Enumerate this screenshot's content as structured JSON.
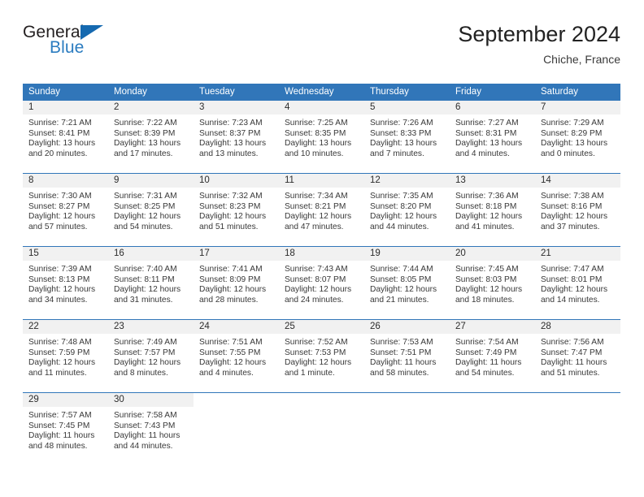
{
  "brand": {
    "name_part1": "General",
    "name_part2": "Blue"
  },
  "header": {
    "title": "September 2024",
    "location": "Chiche, France",
    "accent_color": "#3176b9",
    "brand_blue": "#2b7cc0"
  },
  "weekdays": [
    "Sunday",
    "Monday",
    "Tuesday",
    "Wednesday",
    "Thursday",
    "Friday",
    "Saturday"
  ],
  "weeks": [
    [
      {
        "day": "1",
        "sunrise": "Sunrise: 7:21 AM",
        "sunset": "Sunset: 8:41 PM",
        "daylight": "Daylight: 13 hours and 20 minutes."
      },
      {
        "day": "2",
        "sunrise": "Sunrise: 7:22 AM",
        "sunset": "Sunset: 8:39 PM",
        "daylight": "Daylight: 13 hours and 17 minutes."
      },
      {
        "day": "3",
        "sunrise": "Sunrise: 7:23 AM",
        "sunset": "Sunset: 8:37 PM",
        "daylight": "Daylight: 13 hours and 13 minutes."
      },
      {
        "day": "4",
        "sunrise": "Sunrise: 7:25 AM",
        "sunset": "Sunset: 8:35 PM",
        "daylight": "Daylight: 13 hours and 10 minutes."
      },
      {
        "day": "5",
        "sunrise": "Sunrise: 7:26 AM",
        "sunset": "Sunset: 8:33 PM",
        "daylight": "Daylight: 13 hours and 7 minutes."
      },
      {
        "day": "6",
        "sunrise": "Sunrise: 7:27 AM",
        "sunset": "Sunset: 8:31 PM",
        "daylight": "Daylight: 13 hours and 4 minutes."
      },
      {
        "day": "7",
        "sunrise": "Sunrise: 7:29 AM",
        "sunset": "Sunset: 8:29 PM",
        "daylight": "Daylight: 13 hours and 0 minutes."
      }
    ],
    [
      {
        "day": "8",
        "sunrise": "Sunrise: 7:30 AM",
        "sunset": "Sunset: 8:27 PM",
        "daylight": "Daylight: 12 hours and 57 minutes."
      },
      {
        "day": "9",
        "sunrise": "Sunrise: 7:31 AM",
        "sunset": "Sunset: 8:25 PM",
        "daylight": "Daylight: 12 hours and 54 minutes."
      },
      {
        "day": "10",
        "sunrise": "Sunrise: 7:32 AM",
        "sunset": "Sunset: 8:23 PM",
        "daylight": "Daylight: 12 hours and 51 minutes."
      },
      {
        "day": "11",
        "sunrise": "Sunrise: 7:34 AM",
        "sunset": "Sunset: 8:21 PM",
        "daylight": "Daylight: 12 hours and 47 minutes."
      },
      {
        "day": "12",
        "sunrise": "Sunrise: 7:35 AM",
        "sunset": "Sunset: 8:20 PM",
        "daylight": "Daylight: 12 hours and 44 minutes."
      },
      {
        "day": "13",
        "sunrise": "Sunrise: 7:36 AM",
        "sunset": "Sunset: 8:18 PM",
        "daylight": "Daylight: 12 hours and 41 minutes."
      },
      {
        "day": "14",
        "sunrise": "Sunrise: 7:38 AM",
        "sunset": "Sunset: 8:16 PM",
        "daylight": "Daylight: 12 hours and 37 minutes."
      }
    ],
    [
      {
        "day": "15",
        "sunrise": "Sunrise: 7:39 AM",
        "sunset": "Sunset: 8:13 PM",
        "daylight": "Daylight: 12 hours and 34 minutes."
      },
      {
        "day": "16",
        "sunrise": "Sunrise: 7:40 AM",
        "sunset": "Sunset: 8:11 PM",
        "daylight": "Daylight: 12 hours and 31 minutes."
      },
      {
        "day": "17",
        "sunrise": "Sunrise: 7:41 AM",
        "sunset": "Sunset: 8:09 PM",
        "daylight": "Daylight: 12 hours and 28 minutes."
      },
      {
        "day": "18",
        "sunrise": "Sunrise: 7:43 AM",
        "sunset": "Sunset: 8:07 PM",
        "daylight": "Daylight: 12 hours and 24 minutes."
      },
      {
        "day": "19",
        "sunrise": "Sunrise: 7:44 AM",
        "sunset": "Sunset: 8:05 PM",
        "daylight": "Daylight: 12 hours and 21 minutes."
      },
      {
        "day": "20",
        "sunrise": "Sunrise: 7:45 AM",
        "sunset": "Sunset: 8:03 PM",
        "daylight": "Daylight: 12 hours and 18 minutes."
      },
      {
        "day": "21",
        "sunrise": "Sunrise: 7:47 AM",
        "sunset": "Sunset: 8:01 PM",
        "daylight": "Daylight: 12 hours and 14 minutes."
      }
    ],
    [
      {
        "day": "22",
        "sunrise": "Sunrise: 7:48 AM",
        "sunset": "Sunset: 7:59 PM",
        "daylight": "Daylight: 12 hours and 11 minutes."
      },
      {
        "day": "23",
        "sunrise": "Sunrise: 7:49 AM",
        "sunset": "Sunset: 7:57 PM",
        "daylight": "Daylight: 12 hours and 8 minutes."
      },
      {
        "day": "24",
        "sunrise": "Sunrise: 7:51 AM",
        "sunset": "Sunset: 7:55 PM",
        "daylight": "Daylight: 12 hours and 4 minutes."
      },
      {
        "day": "25",
        "sunrise": "Sunrise: 7:52 AM",
        "sunset": "Sunset: 7:53 PM",
        "daylight": "Daylight: 12 hours and 1 minute."
      },
      {
        "day": "26",
        "sunrise": "Sunrise: 7:53 AM",
        "sunset": "Sunset: 7:51 PM",
        "daylight": "Daylight: 11 hours and 58 minutes."
      },
      {
        "day": "27",
        "sunrise": "Sunrise: 7:54 AM",
        "sunset": "Sunset: 7:49 PM",
        "daylight": "Daylight: 11 hours and 54 minutes."
      },
      {
        "day": "28",
        "sunrise": "Sunrise: 7:56 AM",
        "sunset": "Sunset: 7:47 PM",
        "daylight": "Daylight: 11 hours and 51 minutes."
      }
    ],
    [
      {
        "day": "29",
        "sunrise": "Sunrise: 7:57 AM",
        "sunset": "Sunset: 7:45 PM",
        "daylight": "Daylight: 11 hours and 48 minutes."
      },
      {
        "day": "30",
        "sunrise": "Sunrise: 7:58 AM",
        "sunset": "Sunset: 7:43 PM",
        "daylight": "Daylight: 11 hours and 44 minutes."
      },
      {
        "day": "",
        "sunrise": "",
        "sunset": "",
        "daylight": ""
      },
      {
        "day": "",
        "sunrise": "",
        "sunset": "",
        "daylight": ""
      },
      {
        "day": "",
        "sunrise": "",
        "sunset": "",
        "daylight": ""
      },
      {
        "day": "",
        "sunrise": "",
        "sunset": "",
        "daylight": ""
      },
      {
        "day": "",
        "sunrise": "",
        "sunset": "",
        "daylight": ""
      }
    ]
  ]
}
